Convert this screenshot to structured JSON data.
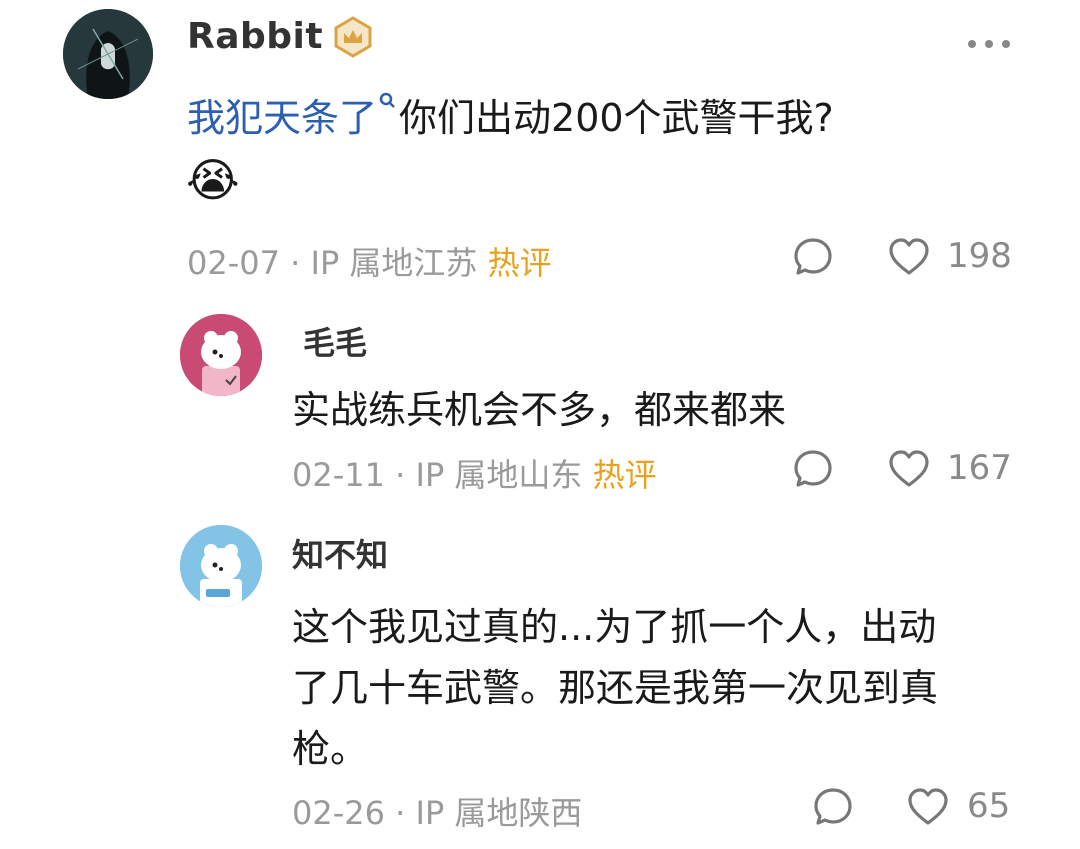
{
  "main_comment": {
    "username": "Rabbit",
    "text_link": "我犯天条了",
    "text_rest": "你们出动200个武警干我?",
    "emoji": "😭",
    "date": "02-07",
    "ip_location": "IP 属地江苏",
    "hot_badge": "热评",
    "like_count": "198",
    "accent_color": "#2d5fb0"
  },
  "replies": [
    {
      "username": "毛毛",
      "text": "实战练兵机会不多，都来都来",
      "date": "02-11",
      "ip_location": "IP 属地山东",
      "hot_badge": "热评",
      "like_count": "167"
    },
    {
      "username": "知不知",
      "text_lines": [
        "这个我见过真的...为了抓一个人，出动",
        "了几十车武警。那还是我第一次见到真",
        "枪。"
      ],
      "date": "02-26",
      "ip_location": "IP 属地陕西",
      "like_count": "65"
    }
  ],
  "separator": "·",
  "icons": [
    "more-icon",
    "verified-crown-icon",
    "search-icon",
    "comment-icon",
    "heart-icon"
  ]
}
